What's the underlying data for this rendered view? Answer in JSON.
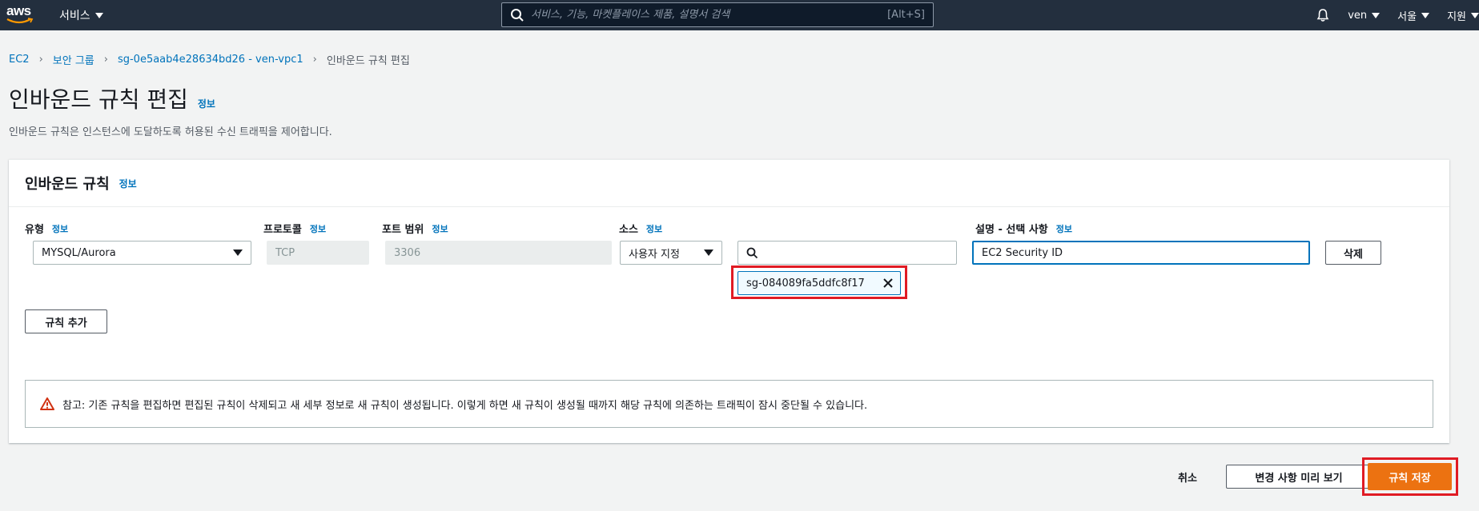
{
  "topnav": {
    "logo_text": "aws",
    "services_label": "서비스",
    "search_placeholder": "서비스, 기능, 마켓플레이스 제품, 설명서 검색",
    "search_shortcut": "[Alt+S]",
    "user_label": "ven",
    "region_label": "서울",
    "support_label": "지원"
  },
  "breadcrumb": {
    "items": [
      "EC2",
      "보안 그룹",
      "sg-0e5aab4e28634bd26 - ven-vpc1"
    ],
    "current": "인바운드 규칙 편집"
  },
  "page": {
    "title": "인바운드 규칙 편집",
    "info": "정보",
    "description": "인바운드 규칙은 인스턴스에 도달하도록 허용된 수신 트래픽을 제어합니다."
  },
  "panel": {
    "title": "인바운드 규칙",
    "info": "정보",
    "labels": {
      "type": "유형",
      "protocol": "프로토콜",
      "port_range": "포트 범위",
      "source": "소스",
      "description": "설명 - 선택 사항",
      "info": "정보"
    },
    "rule": {
      "type_value": "MYSQL/Aurora",
      "protocol_value": "TCP",
      "port_value": "3306",
      "source_type_value": "사용자 지정",
      "source_search_value": "",
      "source_token": "sg-084089fa5ddfc8f17",
      "description_value": "EC2 Security ID",
      "delete_label": "삭제"
    },
    "add_rule_label": "규칙 추가",
    "alert_text": "참고: 기존 규칙을 편집하면 편집된 규칙이 삭제되고 새 세부 정보로 새 규칙이 생성됩니다. 이렇게 하면 새 규칙이 생성될 때까지 해당 규칙에 의존하는 트래픽이 잠시 중단될 수 있습니다."
  },
  "footer": {
    "cancel_label": "취소",
    "preview_label": "변경 사항 미리 보기",
    "save_label": "규칙 저장"
  },
  "colors": {
    "nav_bg": "#232f3e",
    "link": "#0073bb",
    "primary": "#ec7211",
    "highlight": "#e01b24",
    "warning": "#d13212"
  }
}
